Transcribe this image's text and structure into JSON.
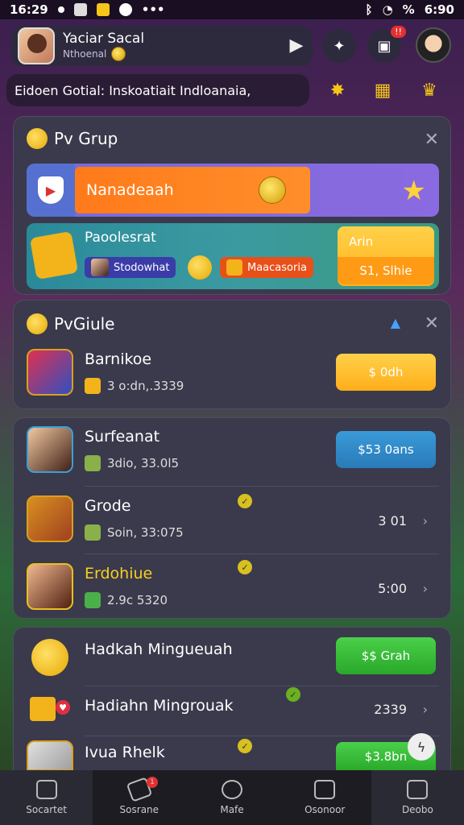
{
  "status_bar": {
    "time_left": "16:29",
    "battery": "%",
    "time_right": "6:90"
  },
  "profile": {
    "name": "Yaciar Sacal",
    "subtitle": "Nthoenal",
    "notification_badge": "!!"
  },
  "ticker": {
    "text": "Eidoen Gotial: Inskoatiait Indloanaia,"
  },
  "group_panel": {
    "title": "Pv Grup",
    "hero_label": "Nanadeaah",
    "promo": {
      "title": "Paoolesrat",
      "chip_blue": "Stodowhat",
      "chip_orange": "Maacasoria",
      "button_top": "Arin",
      "button_bottom": "S1, Slhie"
    }
  },
  "guide_panel": {
    "title": "PvGiule",
    "item": {
      "title": "Barnikoe",
      "sub": "3 o:dn,.3339",
      "button": "$ 0dh"
    }
  },
  "list_panel": {
    "items": [
      {
        "title": "Surfeanat",
        "sub": "3dio, 33.0l5",
        "button": "$53 0ans"
      },
      {
        "title": "Grode",
        "sub": "Soin, 33:075",
        "value": "3 01"
      },
      {
        "title": "Erdohiue",
        "sub": "2.9c 5320",
        "value": "5:00"
      }
    ]
  },
  "reward_panel": {
    "items": [
      {
        "title": "Hadkah Mingueuah",
        "button": "$$ Grah"
      },
      {
        "title": "Hadiahn Mingrouak",
        "value": "2339"
      },
      {
        "title": "Ivua Rhelk",
        "button": "$3.8bn"
      }
    ]
  },
  "bottom_nav": {
    "items": [
      {
        "label": "Socartet"
      },
      {
        "label": "Sosrane",
        "badge": "1"
      },
      {
        "label": "Mafe"
      },
      {
        "label": "Osonoor"
      },
      {
        "label": "Deobo"
      }
    ]
  },
  "colors": {
    "accent_orange": "#ff7a1a",
    "accent_gold": "#ffc22a",
    "panel_bg": "#3a3a4c",
    "green_button": "#3ac03a"
  }
}
